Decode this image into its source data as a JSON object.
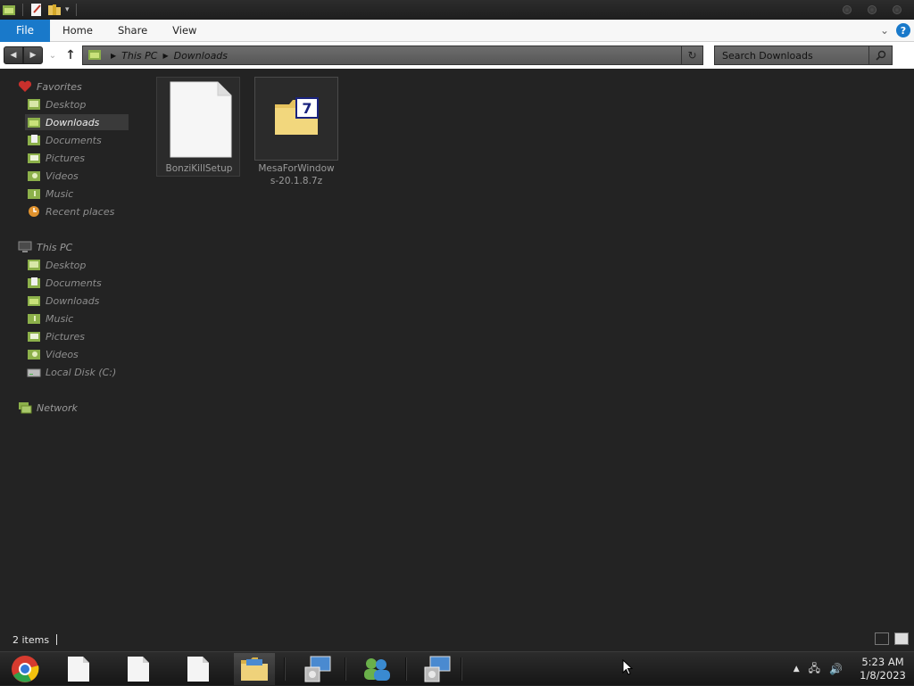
{
  "ribbon": {
    "file": "File",
    "tabs": [
      "Home",
      "Share",
      "View"
    ],
    "help": "?"
  },
  "address": {
    "crumbs": [
      "This PC",
      "Downloads"
    ]
  },
  "search": {
    "placeholder": "Search Downloads"
  },
  "nav": {
    "favorites": {
      "label": "Favorites",
      "items": [
        "Desktop",
        "Downloads",
        "Documents",
        "Pictures",
        "Videos",
        "Music",
        "Recent places"
      ]
    },
    "thispc": {
      "label": "This PC",
      "items": [
        "Desktop",
        "Documents",
        "Downloads",
        "Music",
        "Pictures",
        "Videos",
        "Local Disk (C:)"
      ]
    },
    "network": {
      "label": "Network"
    }
  },
  "files": [
    {
      "name": "BonziKillSetup",
      "icon": "blank-document-icon"
    },
    {
      "name_line1": "MesaForWindow",
      "name_line2": "s-20.1.8.7z",
      "icon": "7zip-archive-icon"
    }
  ],
  "status": {
    "count": "2 items"
  },
  "taskbar": {
    "time": "5:23 AM",
    "date": "1/8/2023"
  },
  "colors": {
    "accent": "#1979ca",
    "background": "#232323"
  }
}
